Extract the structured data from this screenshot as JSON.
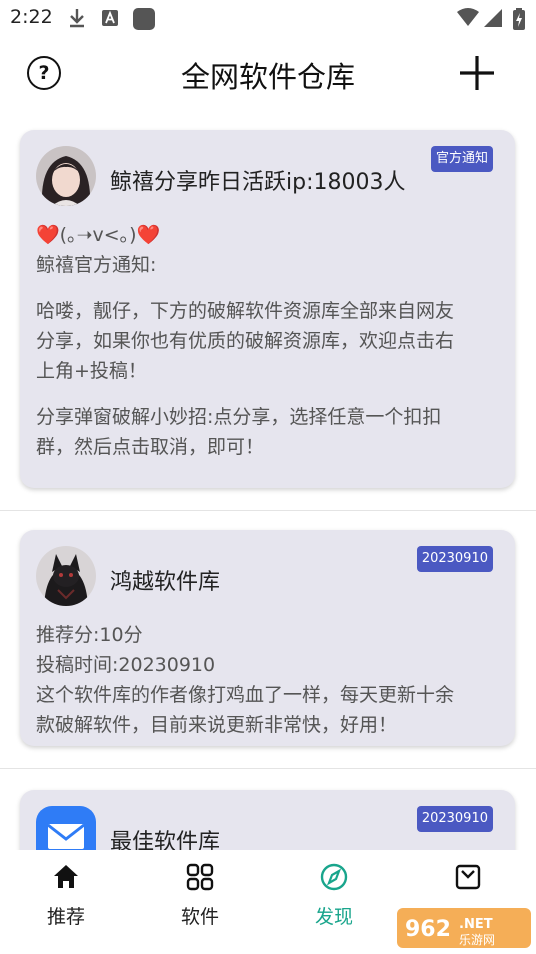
{
  "status_bar": {
    "time": "2:22",
    "icons": [
      "download-icon",
      "font-app-icon",
      "app-square-icon",
      "wifi-icon",
      "signal-icon",
      "battery-icon"
    ]
  },
  "header": {
    "help_icon": "?",
    "title": "全网软件仓库",
    "add_icon": "plus-icon"
  },
  "cards": [
    {
      "name": "鲸禧分享昨日活跃ip:18003人",
      "badge": "官方通知",
      "lines": [
        "❤️(｡➝v<｡)❤️",
        "鲸禧官方通知:",
        "",
        "哈喽，靓仔，下方的破解软件资源库全部来自网友",
        "分享，如果你也有优质的破解资源库，欢迎点击右",
        "上角+投稿！",
        "",
        "分享弹窗破解小妙招:点分享，选择任意一个扣扣",
        "群，然后点击取消，即可！"
      ]
    },
    {
      "name": "鸿越软件库",
      "badge": "20230910",
      "lines": [
        "推荐分:10分",
        "投稿时间:20230910",
        "这个软件库的作者像打鸡血了一样，每天更新十余",
        "款破解软件，目前来说更新非常快，好用！"
      ]
    },
    {
      "name": "最佳软件库",
      "badge": "20230910",
      "lines": []
    }
  ],
  "bottom_nav": [
    {
      "label": "推荐",
      "icon": "home-icon",
      "active": false
    },
    {
      "label": "软件",
      "icon": "grid-icon",
      "active": false
    },
    {
      "label": "发现",
      "icon": "compass-icon",
      "active": true
    },
    {
      "label": "",
      "icon": "mailbox-icon",
      "active": false
    }
  ],
  "colors": {
    "accent": "#19a58c",
    "badge": "#4b59c2",
    "card_bg": "#e6e5ee"
  }
}
